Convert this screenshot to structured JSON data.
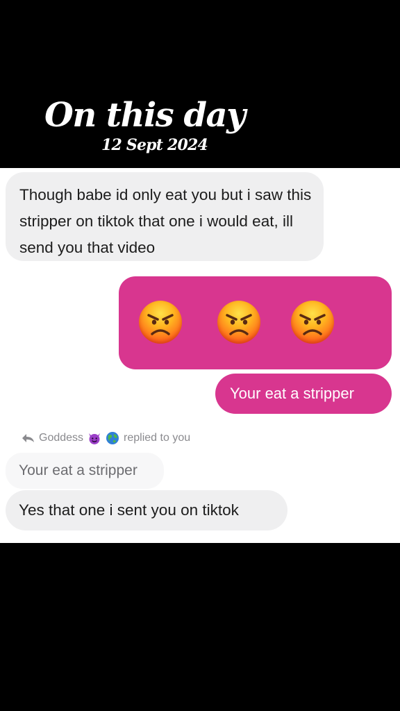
{
  "header": {
    "title": "On this day",
    "date": "12 Sept 2024"
  },
  "messages": {
    "incoming_1": "Though babe id only eat you but i saw this stripper on tiktok that one i would eat,  ill send you that video",
    "outgoing_emoji": [
      "angry-face-icon",
      "angry-face-icon",
      "angry-face-icon"
    ],
    "outgoing_text": "Your eat a stripper",
    "reply_indicator": {
      "name": "Goddess",
      "icons": [
        "smiling-devil-icon",
        "globe-icon"
      ],
      "text": "replied to you"
    },
    "quoted_text": "Your eat a stripper",
    "incoming_2": "Yes that one i sent you on tiktok"
  },
  "colors": {
    "background": "#000000",
    "chat_background": "#ffffff",
    "incoming_bubble": "#efeff0",
    "outgoing_bubble": "#d8368f",
    "meta_text": "#8a8a8e"
  }
}
